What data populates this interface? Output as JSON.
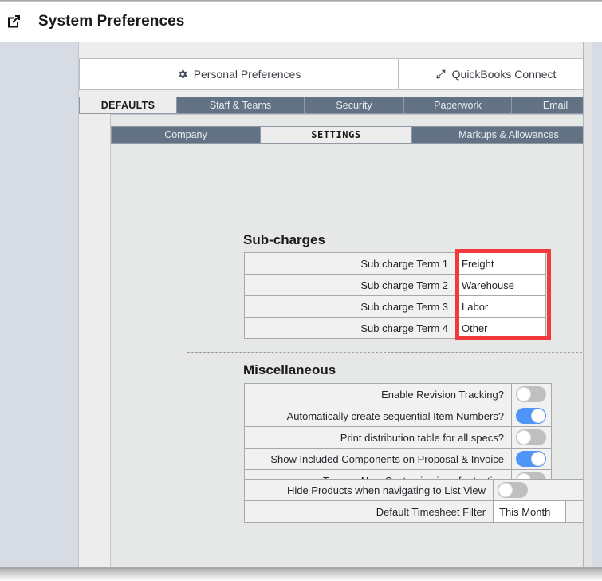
{
  "header": {
    "title": "System Preferences",
    "external_link_icon": "external-link-icon"
  },
  "top_buttons": [
    {
      "label": "Personal Preferences",
      "icon": "gear-icon"
    },
    {
      "label": "QuickBooks Connect",
      "icon": "expand-diagonal-icon"
    }
  ],
  "tabs": [
    {
      "label": "DEFAULTS",
      "active": true
    },
    {
      "label": "Staff & Teams",
      "active": false
    },
    {
      "label": "Security",
      "active": false
    },
    {
      "label": "Paperwork",
      "active": false
    },
    {
      "label": "Email",
      "active": false
    }
  ],
  "subtabs": [
    {
      "label": "Company",
      "active": false
    },
    {
      "label": "SETTINGS",
      "active": true
    },
    {
      "label": "Markups & Allowances",
      "active": false
    }
  ],
  "sections": {
    "sub_charges": {
      "title": "Sub-charges",
      "rows": [
        {
          "label": "Sub charge Term 1",
          "value": "Freight"
        },
        {
          "label": "Sub charge Term 2",
          "value": "Warehouse"
        },
        {
          "label": "Sub charge Term 3",
          "value": "Labor"
        },
        {
          "label": "Sub charge Term 4",
          "value": "Other"
        }
      ]
    },
    "miscellaneous": {
      "title": "Miscellaneous",
      "rows": [
        {
          "label": "Enable Revision Tracking?",
          "on": false
        },
        {
          "label": "Automatically create sequential Item Numbers?",
          "on": true
        },
        {
          "label": "Print distribution table for all specs?",
          "on": false
        },
        {
          "label": "Show Included Components on Proposal & Invoice",
          "on": true
        },
        {
          "label": "Turn on New Customizations for testing",
          "on": false
        }
      ]
    },
    "bottom": {
      "toggle_row": {
        "label": "Hide Products when navigating to List View",
        "on": false
      },
      "select_row": {
        "label": "Default Timesheet Filter",
        "value": "This Month"
      }
    }
  },
  "annotation": {
    "highlight_color": "#f2393c",
    "target": "sub-charge-values-column"
  },
  "colors": {
    "tab_inactive_bg": "#627183",
    "tab_active_bg": "#ededed",
    "toggle_on": "#4f95f7",
    "toggle_off": "#bfbfbf",
    "page_bg": "#d6dbe4",
    "panel_bg": "#e6e8e7"
  }
}
